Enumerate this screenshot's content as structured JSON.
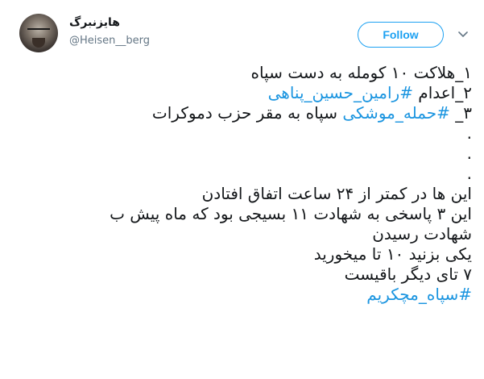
{
  "user": {
    "display_name": "هایزنبرگ",
    "handle": "@Heisen__berg"
  },
  "header": {
    "follow_label": "Follow"
  },
  "colors": {
    "accent": "#1da1f2",
    "hashtag": "#1b95e0",
    "text": "#14171a",
    "muted": "#657786"
  },
  "tweet": {
    "lines": [
      {
        "text": "۱_هلاکت ۱۰ کومله به دست سپاه",
        "hashtag": ""
      },
      {
        "text": "۲_اعدام ",
        "hashtag": "#رامین_حسین_پناهی"
      },
      {
        "text": "۳_ ",
        "hashtag": "#حمله_موشکی",
        "after": " سپاه به مقر حزب دموکرات"
      },
      {
        "text": "."
      },
      {
        "text": "."
      },
      {
        "text": "."
      },
      {
        "text": "این ها در کمتر از ۲۴ ساعت اتفاق افتادن"
      },
      {
        "text": "این ۳ پاسخی به شهادت ۱۱ بسیجی بود که ماه پیش ب"
      },
      {
        "text": "شهادت رسیدن"
      },
      {
        "text": "یکی بزنید ۱۰ تا میخورید"
      },
      {
        "text": "۷ تای دیگر باقیست"
      },
      {
        "text": "",
        "hashtag": "#سپاه_مچکریم"
      }
    ]
  }
}
